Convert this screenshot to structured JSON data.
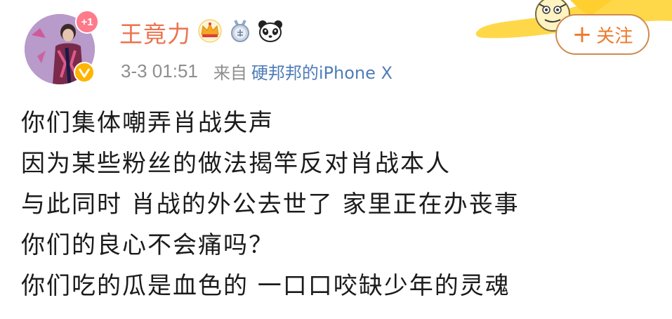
{
  "author": {
    "name": "王竟力",
    "avatar_badge": "+1",
    "name_color": "#eb7350",
    "icons": [
      "crown-icon",
      "medal-icon",
      "panda-icon"
    ],
    "verified_color": "#ffb400"
  },
  "meta": {
    "time": "3-3 01:51",
    "from_label": "来自",
    "source": "硬邦邦的iPhone X"
  },
  "follow_button": {
    "plus": "+",
    "label": "关注",
    "color": "#eb7a2b"
  },
  "post": {
    "lines": [
      "你们集体嘲弄肖战失声",
      "因为某些粉丝的做法揭竿反对肖战本人",
      "与此同时 肖战的外公去世了 家里正在办丧事",
      "你们的良心不会痛吗？",
      "你们吃的瓜是血色的 一口口咬缺少年的灵魂"
    ]
  }
}
